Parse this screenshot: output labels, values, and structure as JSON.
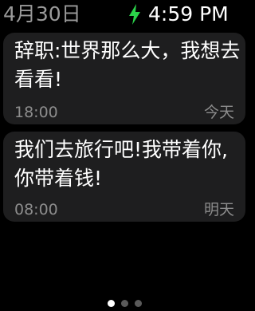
{
  "status_bar": {
    "date": "4月30日",
    "time": "4:59 PM",
    "charging_icon": "lightning-bolt-icon",
    "charging_color": "#2bd34a"
  },
  "notifications": [
    {
      "text": "辞职:世界那么大，我想去看看!",
      "time": "18:00",
      "day": "今天"
    },
    {
      "text": "我们去旅行吧!我带着你,你带着钱!",
      "time": "08:00",
      "day": "明天"
    }
  ],
  "pager": {
    "page_count": 3,
    "active_page": 1
  }
}
